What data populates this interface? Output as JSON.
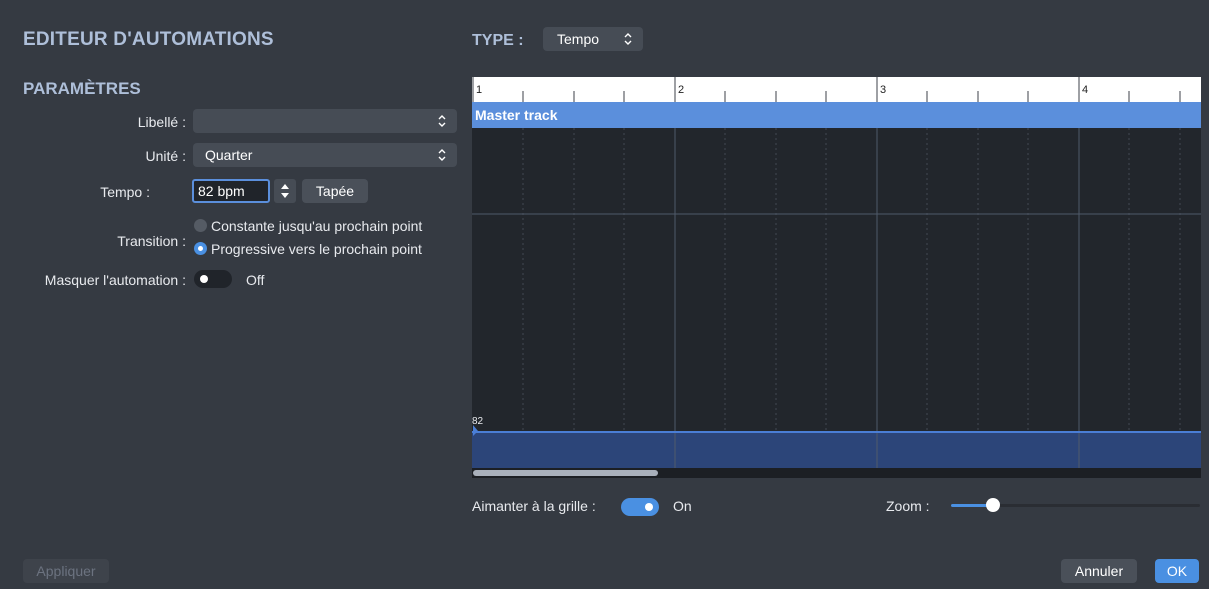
{
  "header": {
    "title": "EDITEUR D'AUTOMATIONS",
    "type_label": "TYPE :",
    "type_value": "Tempo"
  },
  "params": {
    "section": "PARAMÈTRES",
    "libelle_label": "Libellé :",
    "libelle_value": "",
    "unite_label": "Unité :",
    "unite_value": "Quarter",
    "tempo_label": "Tempo :",
    "tempo_value": "82 bpm",
    "tap_label": "Tapée",
    "transition_label": "Transition :",
    "transition_options": [
      {
        "label": "Constante jusqu'au prochain point",
        "selected": false
      },
      {
        "label": "Progressive vers le prochain point",
        "selected": true
      }
    ],
    "hide_label": "Masquer l'automation :",
    "hide_state": "Off"
  },
  "editor": {
    "bars": [
      "1",
      "2",
      "3",
      "4"
    ],
    "track_name": "Master track",
    "automation_value": "82",
    "automation_level": 0.035
  },
  "footer": {
    "snap_label": "Aimanter à la grille :",
    "snap_state": "On",
    "zoom_label": "Zoom :",
    "zoom_level": 0.17,
    "apply_label": "Appliquer",
    "cancel_label": "Annuler",
    "ok_label": "OK"
  },
  "colors": {
    "accent": "#4a90e2",
    "track": "#5b8fdc",
    "heading": "#aebfd9"
  }
}
